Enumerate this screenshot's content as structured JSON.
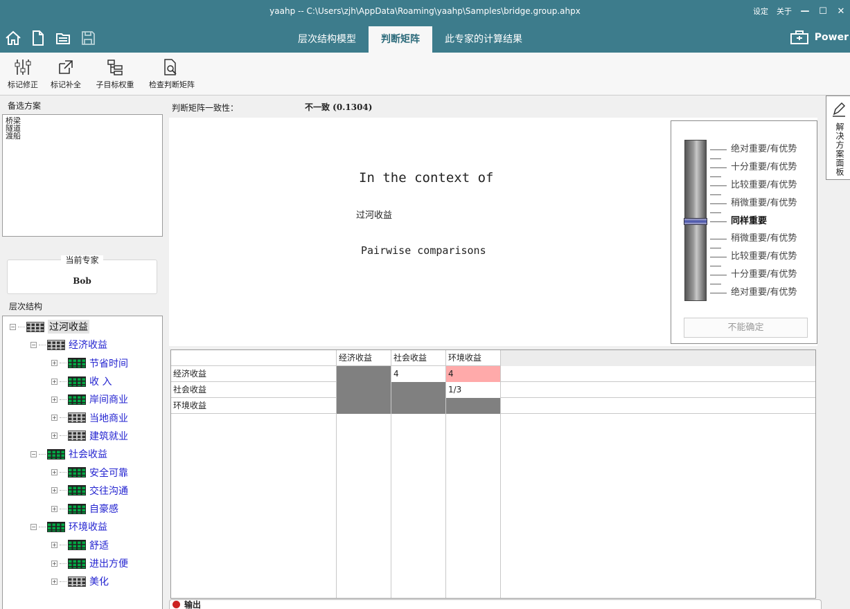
{
  "window": {
    "title": "yaahp -- C:\\Users\\zjh\\AppData\\Roaming\\yaahp\\Samples\\bridge.group.ahpx",
    "settings": "设定",
    "about": "关于",
    "minimize": "—",
    "maximize": "☐",
    "close": "✕"
  },
  "ribbon": {
    "tabs": [
      "层次结构模型",
      "判断矩阵",
      "此专家的计算结果"
    ],
    "power_label": "Power"
  },
  "toolbar": {
    "mark_fix": "标记修正",
    "mark_complete": "标记补全",
    "subgoal_weight": "子目标权重",
    "check_matrix": "检查判断矩阵"
  },
  "left": {
    "alternatives_label": "备选方案",
    "alternatives": [
      "桥梁",
      "隧道",
      "渡船"
    ],
    "current_expert_label": "当前专家",
    "current_expert": "Bob",
    "hierarchy_label": "层次结构"
  },
  "tree": [
    {
      "label": "过河收益",
      "level": 0,
      "icon": "gray",
      "toggle": "−"
    },
    {
      "label": "经济收益",
      "level": 1,
      "icon": "gray",
      "toggle": "−"
    },
    {
      "label": "节省时间",
      "level": 2,
      "icon": "green",
      "toggle": "+"
    },
    {
      "label": "收 入",
      "level": 2,
      "icon": "green",
      "toggle": "+"
    },
    {
      "label": "岸间商业",
      "level": 2,
      "icon": "green",
      "toggle": "+"
    },
    {
      "label": "当地商业",
      "level": 2,
      "icon": "gray",
      "toggle": "+"
    },
    {
      "label": "建筑就业",
      "level": 2,
      "icon": "gray",
      "toggle": "+"
    },
    {
      "label": "社会收益",
      "level": 1,
      "icon": "green",
      "toggle": "−"
    },
    {
      "label": "安全可靠",
      "level": 2,
      "icon": "green",
      "toggle": "+"
    },
    {
      "label": "交往沟通",
      "level": 2,
      "icon": "green",
      "toggle": "+"
    },
    {
      "label": "自豪感",
      "level": 2,
      "icon": "green",
      "toggle": "+"
    },
    {
      "label": "环境收益",
      "level": 1,
      "icon": "green",
      "toggle": "−"
    },
    {
      "label": "舒适",
      "level": 2,
      "icon": "green",
      "toggle": "+"
    },
    {
      "label": "进出方便",
      "level": 2,
      "icon": "green",
      "toggle": "+"
    },
    {
      "label": "美化",
      "level": 2,
      "icon": "gray",
      "toggle": "+"
    }
  ],
  "consistency": {
    "label": "判断矩阵一致性：",
    "value": "不一致 (0.1304)"
  },
  "context": {
    "title": "In the context of",
    "node": "过河收益",
    "subtitle": "Pairwise comparisons"
  },
  "scale": {
    "items": [
      "绝对重要/有优势",
      "十分重要/有优势",
      "比较重要/有优势",
      "稍微重要/有优势",
      "同样重要",
      "稍微重要/有优势",
      "比较重要/有优势",
      "十分重要/有优势",
      "绝对重要/有优势"
    ],
    "selected_index": 4,
    "uncertain_label": "不能确定"
  },
  "matrix": {
    "headers": [
      "经济收益",
      "社会收益",
      "环境收益"
    ],
    "rows": [
      {
        "label": "经济收益",
        "cells": [
          "",
          "4",
          "4"
        ],
        "states": [
          "diag",
          "normal",
          "highlight"
        ]
      },
      {
        "label": "社会收益",
        "cells": [
          "",
          "",
          "1/3"
        ],
        "states": [
          "diag",
          "diag",
          "normal"
        ]
      },
      {
        "label": "环境收益",
        "cells": [
          "",
          "",
          ""
        ],
        "states": [
          "diag",
          "diag",
          "diag"
        ]
      }
    ],
    "colors": {
      "diag": "#808080",
      "highlight": "#ffaaaa",
      "normal": "#ffffff"
    }
  },
  "output": {
    "label": "输出"
  },
  "side_panel": {
    "label": "解决方案面板"
  }
}
